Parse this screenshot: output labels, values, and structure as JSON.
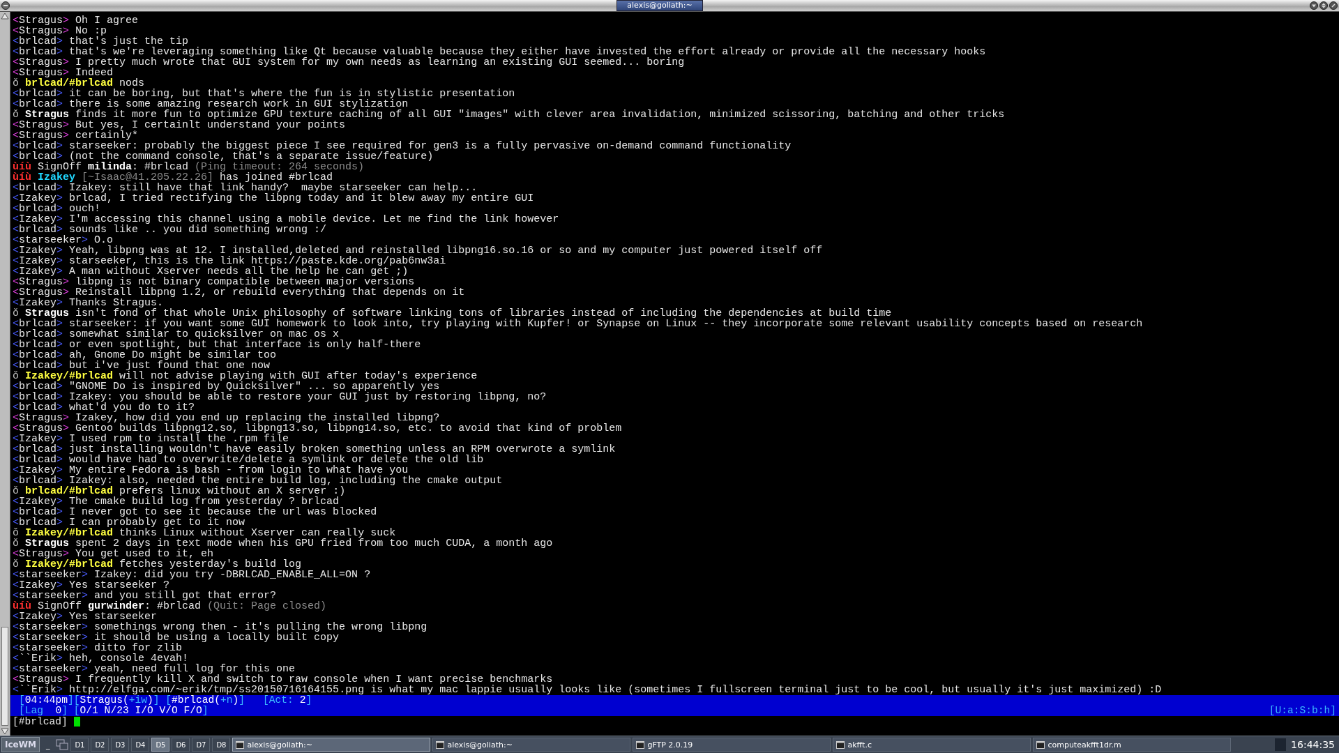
{
  "window": {
    "title": "alexis@goliath:~"
  },
  "lines": [
    {
      "kind": "message",
      "self": true,
      "open": "<",
      "nick": "Stragus",
      "close": ">",
      "text": "Oh I agree"
    },
    {
      "kind": "message",
      "self": true,
      "open": "<",
      "nick": "Stragus",
      "close": ">",
      "text": "No :p"
    },
    {
      "kind": "message",
      "self": false,
      "open": "<",
      "nick": "brlcad",
      "close": ">",
      "text": "that's just the tip"
    },
    {
      "kind": "message",
      "self": false,
      "open": "<",
      "nick": "brlcad",
      "close": ">",
      "text": "that's we're leveraging something like Qt because valuable because they either have invested the effort already or provide all the necessary hooks"
    },
    {
      "kind": "message",
      "self": true,
      "open": "<",
      "nick": "Stragus",
      "close": ">",
      "text": "I pretty much wrote that GUI system for my own needs as learning an existing GUI seemed... boring"
    },
    {
      "kind": "message",
      "self": true,
      "open": "<",
      "nick": "Stragus",
      "close": ">",
      "text": "Indeed"
    },
    {
      "kind": "action",
      "marker": "ǒ",
      "highlight": true,
      "nick": "brlcad/#brlcad",
      "text": "nods"
    },
    {
      "kind": "message",
      "self": false,
      "open": "<",
      "nick": "brlcad",
      "close": ">",
      "text": "it can be boring, but that's where the fun is in stylistic presentation"
    },
    {
      "kind": "message",
      "self": false,
      "open": "<",
      "nick": "brlcad",
      "close": ">",
      "text": "there is some amazing research work in GUI stylization"
    },
    {
      "kind": "action",
      "marker": "ǒ",
      "highlight": false,
      "nick": "Stragus",
      "text": "finds it more fun to optimize GPU texture caching of all GUI \"images\" with clever area invalidation, minimized scissoring, batching and other tricks"
    },
    {
      "kind": "message",
      "self": true,
      "open": "<",
      "nick": "Stragus",
      "close": ">",
      "text": "But yes, I certainlt understand your points"
    },
    {
      "kind": "message",
      "self": true,
      "open": "<",
      "nick": "Stragus",
      "close": ">",
      "text": "certainly*"
    },
    {
      "kind": "message",
      "self": false,
      "open": "<",
      "nick": "brlcad",
      "close": ">",
      "text": "starseeker: probably the biggest piece I see required for gen3 is a fully pervasive on-demand command functionality"
    },
    {
      "kind": "message",
      "self": false,
      "open": "<",
      "nick": "brlcad",
      "close": ">",
      "text": "(not the command console, that's a separate issue/feature)"
    },
    {
      "kind": "event",
      "marker": "ùíù",
      "segments": [
        {
          "kind": "plain",
          "text": "SignOff "
        },
        {
          "kind": "bold",
          "text": "milinda"
        },
        {
          "kind": "plain",
          "text": ": #brlcad "
        },
        {
          "kind": "dim",
          "text": "(Ping timeout: 264 seconds)"
        }
      ]
    },
    {
      "kind": "event",
      "marker": "ùíù",
      "segments": [
        {
          "kind": "cyan",
          "text": "Izakey"
        },
        {
          "kind": "dim",
          "text": " [~Isaac@41.205.22.26]"
        },
        {
          "kind": "plain",
          "text": " has joined #brlcad"
        }
      ]
    },
    {
      "kind": "message",
      "self": false,
      "open": "<",
      "nick": "brlcad",
      "close": ">",
      "text": "Izakey: still have that link handy?  maybe starseeker can help..."
    },
    {
      "kind": "message",
      "self": false,
      "open": "<",
      "nick": "Izakey",
      "close": ">",
      "text": "brlcad, I tried rectifying the libpng today and it blew away my entire GUI"
    },
    {
      "kind": "message",
      "self": false,
      "open": "<",
      "nick": "brlcad",
      "close": ">",
      "text": "ouch!"
    },
    {
      "kind": "message",
      "self": false,
      "open": "<",
      "nick": "Izakey",
      "close": ">",
      "text": "I'm accessing this channel using a mobile device. Let me find the link however"
    },
    {
      "kind": "message",
      "self": false,
      "open": "<",
      "nick": "brlcad",
      "close": ">",
      "text": "sounds like .. you did something wrong :/"
    },
    {
      "kind": "message",
      "self": false,
      "open": "<",
      "nick": "starseeker",
      "close": ">",
      "text": "O.o"
    },
    {
      "kind": "message",
      "self": false,
      "open": "<",
      "nick": "Izakey",
      "close": ">",
      "text": "Yeah, libpng was at 12. I installed,deleted and reinstalled libpng16.so.16 or so and my computer just powered itself off"
    },
    {
      "kind": "message",
      "self": false,
      "open": "<",
      "nick": "Izakey",
      "close": ">",
      "text": "starseeker, this is the link https://paste.kde.org/pab6nw3ai"
    },
    {
      "kind": "message",
      "self": false,
      "open": "<",
      "nick": "Izakey",
      "close": ">",
      "text": "A man without Xserver needs all the help he can get ;)"
    },
    {
      "kind": "message",
      "self": true,
      "open": "<",
      "nick": "Stragus",
      "close": ">",
      "text": "libpng is not binary compatible between major versions"
    },
    {
      "kind": "message",
      "self": true,
      "open": "<",
      "nick": "Stragus",
      "close": ">",
      "text": "Reinstall libpng 1.2, or rebuild everything that depends on it"
    },
    {
      "kind": "message",
      "self": false,
      "open": "<",
      "nick": "Izakey",
      "close": ">",
      "text": "Thanks Stragus."
    },
    {
      "kind": "action",
      "marker": "ǒ",
      "highlight": false,
      "nick": "Stragus",
      "text": "isn't fond of that whole Unix philosophy of software linking tons of libraries instead of including the dependencies at build time"
    },
    {
      "kind": "message",
      "self": false,
      "open": "<",
      "nick": "brlcad",
      "close": ">",
      "text": "starseeker: if you want some GUI homework to look into, try playing with Kupfer! or Synapse on Linux -- they incorporate some relevant usability concepts based on research"
    },
    {
      "kind": "message",
      "self": false,
      "open": "<",
      "nick": "brlcad",
      "close": ">",
      "text": "somewhat similar to quicksilver on mac os x"
    },
    {
      "kind": "message",
      "self": false,
      "open": "<",
      "nick": "brlcad",
      "close": ">",
      "text": "or even spotlight, but that interface is only half-there"
    },
    {
      "kind": "message",
      "self": false,
      "open": "<",
      "nick": "brlcad",
      "close": ">",
      "text": "ah, Gnome Do might be similar too"
    },
    {
      "kind": "message",
      "self": false,
      "open": "<",
      "nick": "brlcad",
      "close": ">",
      "text": "but i've just found that one now"
    },
    {
      "kind": "action",
      "marker": "ǒ",
      "highlight": true,
      "nick": "Izakey/#brlcad",
      "text": "will not advise playing with GUI after today's experience"
    },
    {
      "kind": "message",
      "self": false,
      "open": "<",
      "nick": "brlcad",
      "close": ">",
      "text": "\"GNOME Do is inspired by Quicksilver\" ... so apparently yes"
    },
    {
      "kind": "message",
      "self": false,
      "open": "<",
      "nick": "brlcad",
      "close": ">",
      "text": "Izakey: you should be able to restore your GUI just by restoring libpng, no?"
    },
    {
      "kind": "message",
      "self": false,
      "open": "<",
      "nick": "brlcad",
      "close": ">",
      "text": "what'd you do to it?"
    },
    {
      "kind": "message",
      "self": true,
      "open": "<",
      "nick": "Stragus",
      "close": ">",
      "text": "Izakey, how did you end up replacing the installed libpng?"
    },
    {
      "kind": "message",
      "self": true,
      "open": "<",
      "nick": "Stragus",
      "close": ">",
      "text": "Gentoo builds libpng12.so, libpng13.so, libpng14.so, etc. to avoid that kind of problem"
    },
    {
      "kind": "message",
      "self": false,
      "open": "<",
      "nick": "Izakey",
      "close": ">",
      "text": "I used rpm to install the .rpm file"
    },
    {
      "kind": "message",
      "self": false,
      "open": "<",
      "nick": "brlcad",
      "close": ">",
      "text": "just installing wouldn't have easily broken something unless an RPM overwrote a symlink"
    },
    {
      "kind": "message",
      "self": false,
      "open": "<",
      "nick": "brlcad",
      "close": ">",
      "text": "would have had to overwrite/delete a symlink or delete the old lib"
    },
    {
      "kind": "message",
      "self": false,
      "open": "<",
      "nick": "Izakey",
      "close": ">",
      "text": "My entire Fedora is bash - from login to what have you"
    },
    {
      "kind": "message",
      "self": false,
      "open": "<",
      "nick": "brlcad",
      "close": ">",
      "text": "Izakey: also, needed the entire build log, including the cmake output"
    },
    {
      "kind": "action",
      "marker": "ǒ",
      "highlight": true,
      "nick": "brlcad/#brlcad",
      "text": "prefers linux without an X server :)"
    },
    {
      "kind": "message",
      "self": false,
      "open": "<",
      "nick": "Izakey",
      "close": ">",
      "text": "The cmake build log from yesterday ? brlcad"
    },
    {
      "kind": "message",
      "self": false,
      "open": "<",
      "nick": "brlcad",
      "close": ">",
      "text": "I never got to see it because the url was blocked"
    },
    {
      "kind": "message",
      "self": false,
      "open": "<",
      "nick": "brlcad",
      "close": ">",
      "text": "I can probably get to it now"
    },
    {
      "kind": "action",
      "marker": "ǒ",
      "highlight": true,
      "nick": "Izakey/#brlcad",
      "text": "thinks Linux without Xserver can really suck"
    },
    {
      "kind": "action",
      "marker": "ǒ",
      "highlight": false,
      "nick": "Stragus",
      "text": "spent 2 days in text mode when his GPU fried from too much CUDA, a month ago"
    },
    {
      "kind": "message",
      "self": true,
      "open": "<",
      "nick": "Stragus",
      "close": ">",
      "text": "You get used to it, eh"
    },
    {
      "kind": "action",
      "marker": "ǒ",
      "highlight": true,
      "nick": "Izakey/#brlcad",
      "text": "fetches yesterday's build log"
    },
    {
      "kind": "message",
      "self": false,
      "open": "<",
      "nick": "starseeker",
      "close": ">",
      "text": "Izakey: did you try -DBRLCAD_ENABLE_ALL=ON ?"
    },
    {
      "kind": "message",
      "self": false,
      "open": "<",
      "nick": "Izakey",
      "close": ">",
      "text": "Yes starseeker ?"
    },
    {
      "kind": "message",
      "self": false,
      "open": "<",
      "nick": "starseeker",
      "close": ">",
      "text": "and you still got that error?"
    },
    {
      "kind": "event",
      "marker": "ùíù",
      "segments": [
        {
          "kind": "plain",
          "text": "SignOff "
        },
        {
          "kind": "bold",
          "text": "gurwinder"
        },
        {
          "kind": "plain",
          "text": ": #brlcad "
        },
        {
          "kind": "dim",
          "text": "(Quit: Page closed)"
        }
      ]
    },
    {
      "kind": "message",
      "self": false,
      "open": "<",
      "nick": "Izakey",
      "close": ">",
      "text": "Yes starseeker"
    },
    {
      "kind": "message",
      "self": false,
      "open": "<",
      "nick": "starseeker",
      "close": ">",
      "text": "somethings wrong then - it's pulling the wrong libpng"
    },
    {
      "kind": "message",
      "self": false,
      "open": "<",
      "nick": "starseeker",
      "close": ">",
      "text": "it should be using a locally built copy"
    },
    {
      "kind": "message",
      "self": false,
      "open": "<",
      "nick": "starseeker",
      "close": ">",
      "text": "ditto for zlib"
    },
    {
      "kind": "message",
      "self": false,
      "open": "<",
      "nick": "``Erik",
      "close": ">",
      "text": "heh, console 4evah!"
    },
    {
      "kind": "message",
      "self": false,
      "open": "<",
      "nick": "starseeker",
      "close": ">",
      "text": "yeah, need full log for this one"
    },
    {
      "kind": "message",
      "self": true,
      "open": "<",
      "nick": "Stragus",
      "close": ">",
      "text": "I frequently kill X and switch to raw console when I want precise benchmarks"
    },
    {
      "kind": "message",
      "self": false,
      "open": "<",
      "nick": "``Erik",
      "close": ">",
      "text": "http://elfga.com/~erik/tmp/ss20150716164155.png is what my mac lappie usually looks like (sometimes I fullscreen terminal just to be cool, but usually it's just maximized) :D"
    }
  ],
  "status_bar": {
    "rows": [
      {
        "left": [
          {
            "segments": [
              {
                "kind": "accent",
                "text": "["
              },
              {
                "kind": "value",
                "text": "04:44pm"
              },
              {
                "kind": "accent",
                "text": "]["
              },
              {
                "kind": "value",
                "text": "Stragus("
              },
              {
                "kind": "accent",
                "text": "+iw"
              },
              {
                "kind": "value",
                "text": ")"
              },
              {
                "kind": "accent",
                "text": "] ["
              },
              {
                "kind": "value",
                "text": "#brlcad("
              },
              {
                "kind": "accent",
                "text": "+n"
              },
              {
                "kind": "value",
                "text": ")"
              },
              {
                "kind": "accent",
                "text": "]"
              }
            ]
          },
          {
            "segments": [
              {
                "kind": "accent",
                "text": "[Act: "
              },
              {
                "kind": "value",
                "text": "2"
              },
              {
                "kind": "accent",
                "text": "]"
              }
            ]
          }
        ],
        "right": []
      },
      {
        "left": [
          {
            "segments": [
              {
                "kind": "accent",
                "text": "[Lag  "
              },
              {
                "kind": "value",
                "text": "0"
              },
              {
                "kind": "accent",
                "text": "] ["
              },
              {
                "kind": "value",
                "text": "O/1 N/23 I/O V/O F/O"
              },
              {
                "kind": "accent",
                "text": "]"
              }
            ]
          }
        ],
        "right": [
          {
            "segments": [
              {
                "kind": "accent",
                "text": "[U:a:S:b:h]"
              }
            ]
          }
        ]
      }
    ]
  },
  "input": {
    "prompt": "[#brlcad]"
  },
  "taskbar": {
    "start": "IceWM",
    "show_desktop": "_",
    "workspaces": [
      {
        "label": "D1",
        "selected": false
      },
      {
        "label": "D2",
        "selected": false
      },
      {
        "label": "D3",
        "selected": false
      },
      {
        "label": "D4",
        "selected": false
      },
      {
        "label": "D5",
        "selected": true
      },
      {
        "label": "D6",
        "selected": false
      },
      {
        "label": "D7",
        "selected": false
      },
      {
        "label": "D8",
        "selected": false
      }
    ],
    "tasks": [
      {
        "label": "alexis@goliath:~",
        "selected": true
      },
      {
        "label": "alexis@goliath:~",
        "selected": false
      },
      {
        "label": "gFTP 2.0.19",
        "selected": false
      },
      {
        "label": "akfft.c",
        "selected": false
      },
      {
        "label": "computeakfft1dr.m",
        "selected": false
      }
    ],
    "clock": "16:44:35"
  }
}
